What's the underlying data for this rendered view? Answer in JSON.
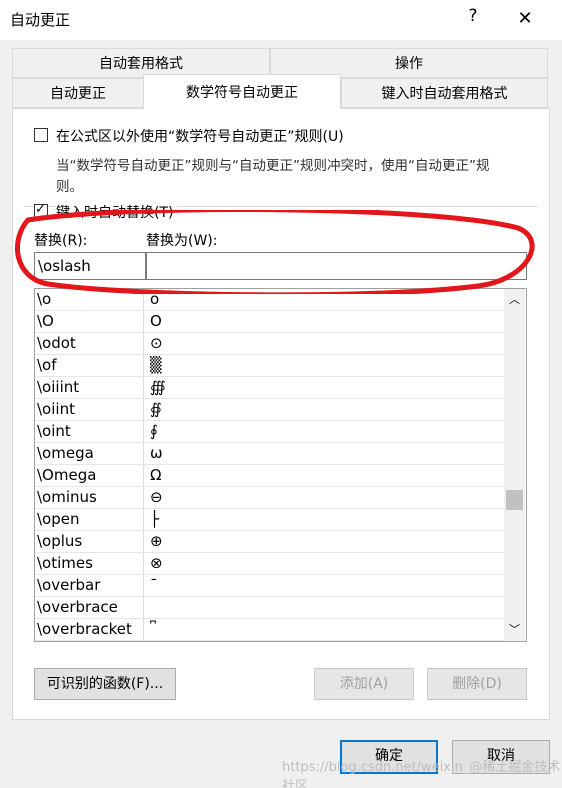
{
  "window": {
    "title": "自动更正",
    "help": "?",
    "close": "✕"
  },
  "tabs_top": [
    "自动套用格式",
    "操作"
  ],
  "tabs_bottom": [
    "自动更正",
    "数学符号自动更正",
    "键入时自动套用格式"
  ],
  "options": {
    "outside_label": "在公式区以外使用“数学符号自动更正”规则(U)",
    "note_line1": "当“数学符号自动更正”规则与“自动更正”规则冲突时，使用“自动更正”规",
    "note_line2": "则。",
    "replace_as_type_label": "键入时自动替换(T)"
  },
  "fields": {
    "replace_label": "替换(R):",
    "with_label": "替换为(W):",
    "replace_value": "\\oslash",
    "with_value": ""
  },
  "list": [
    {
      "k": "\\o",
      "v": "ο"
    },
    {
      "k": "\\O",
      "v": "Ο"
    },
    {
      "k": "\\odot",
      "v": "⊙"
    },
    {
      "k": "\\of",
      "v": "▒"
    },
    {
      "k": "\\oiiint",
      "v": "∰"
    },
    {
      "k": "\\oiint",
      "v": "∯"
    },
    {
      "k": "\\oint",
      "v": "∮"
    },
    {
      "k": "\\omega",
      "v": "ω"
    },
    {
      "k": "\\Omega",
      "v": "Ω"
    },
    {
      "k": "\\ominus",
      "v": "⊖"
    },
    {
      "k": "\\open",
      "v": "├"
    },
    {
      "k": "\\oplus",
      "v": "⊕"
    },
    {
      "k": "\\otimes",
      "v": "⊗"
    },
    {
      "k": "\\overbar",
      "v": "¯"
    },
    {
      "k": "\\overbrace",
      "v": ""
    },
    {
      "k": "\\overbracket",
      "v": "⎴"
    }
  ],
  "buttons": {
    "functions": "可识别的函数(F)...",
    "add": "添加(A)",
    "delete": "删除(D)",
    "ok": "确定",
    "cancel": "取消"
  },
  "watermark": "https://blog.csdn.net/weixin_@稀土掘金技术社区"
}
